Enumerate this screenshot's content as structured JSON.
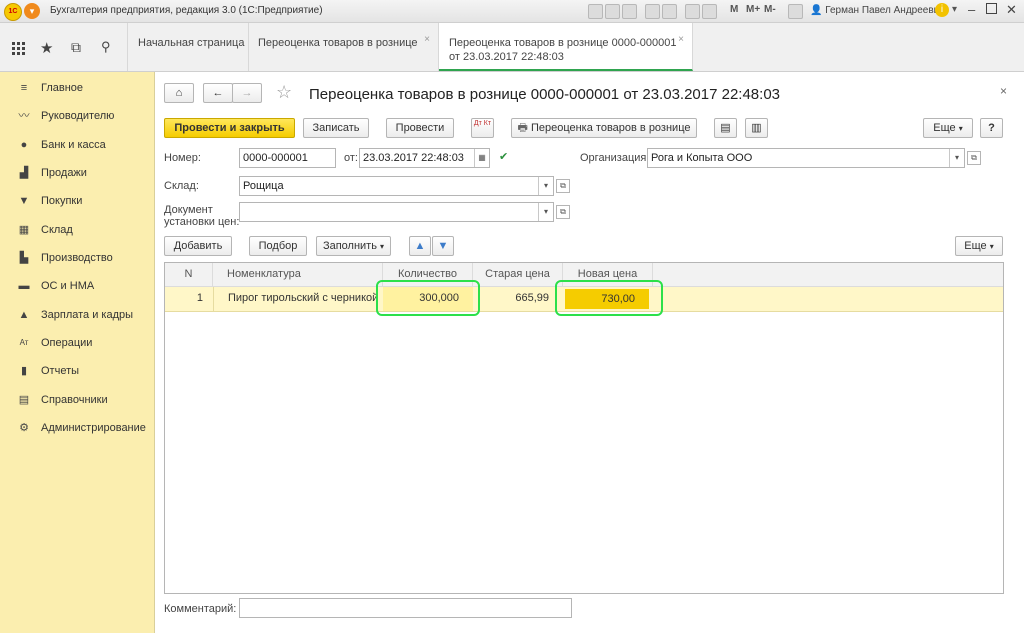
{
  "window": {
    "title": "Бухгалтерия предприятия, редакция 3.0  (1С:Предприятие)",
    "logo_text": "1С",
    "user": "Герман Павел Андреевич",
    "mem_buttons": [
      "M",
      "M+",
      "M-"
    ]
  },
  "tabs": [
    {
      "label": "Начальная страница"
    },
    {
      "label": "Переоценка товаров в рознице"
    },
    {
      "label_line1": "Переоценка товаров в рознице 0000-000001",
      "label_line2": "от 23.03.2017 22:48:03"
    }
  ],
  "sidebar": {
    "items": [
      {
        "label": "Главное",
        "icon": "menu-icon"
      },
      {
        "label": "Руководителю",
        "icon": "trend-icon"
      },
      {
        "label": "Банк и касса",
        "icon": "coin-icon"
      },
      {
        "label": "Продажи",
        "icon": "bag-icon"
      },
      {
        "label": "Покупки",
        "icon": "cart-icon"
      },
      {
        "label": "Склад",
        "icon": "warehouse-icon"
      },
      {
        "label": "Производство",
        "icon": "factory-icon"
      },
      {
        "label": "ОС и НМА",
        "icon": "truck-icon"
      },
      {
        "label": "Зарплата и кадры",
        "icon": "person-icon"
      },
      {
        "label": "Операции",
        "icon": "dt-kt-icon"
      },
      {
        "label": "Отчеты",
        "icon": "bar-chart-icon"
      },
      {
        "label": "Справочники",
        "icon": "books-icon"
      },
      {
        "label": "Администрирование",
        "icon": "gear-icon"
      }
    ]
  },
  "form": {
    "title": "Переоценка товаров в рознице 0000-000001 от 23.03.2017 22:48:03",
    "buttons": {
      "post_close": "Провести и закрыть",
      "save": "Записать",
      "post": "Провести",
      "dtkt": "Дт Кт",
      "print": "Переоценка товаров в рознице",
      "more": "Еще",
      "help": "?"
    },
    "number_label": "Номер:",
    "number_value": "0000-000001",
    "date_label": "от:",
    "date_value": "23.03.2017 22:48:03",
    "org_label": "Организация:",
    "org_value": "Рога и Копыта ООО",
    "warehouse_label": "Склад:",
    "warehouse_value": "Рощица",
    "pricedoc_label_line1": "Документ",
    "pricedoc_label_line2": "установки цен:",
    "pricedoc_value": "",
    "table_buttons": {
      "add": "Добавить",
      "pick": "Подбор",
      "fill": "Заполнить",
      "more": "Еще"
    },
    "columns": [
      "N",
      "Номенклатура",
      "Количество",
      "Старая цена",
      "Новая цена"
    ],
    "rows": [
      {
        "n": "1",
        "item": "Пирог тирольский с черникой",
        "qty": "300,000",
        "old_price": "665,99",
        "new_price": "730,00"
      }
    ],
    "comment_label": "Комментарий:",
    "comment_value": ""
  },
  "colors": {
    "accent_yellow": "#f5cc00",
    "highlight_green": "#2ce04a",
    "sidebar_bg": "#fbeeaf",
    "active_tab": "#2fa44f"
  }
}
